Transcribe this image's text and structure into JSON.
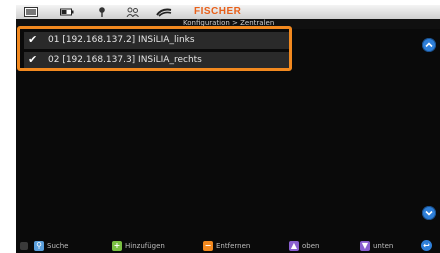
{
  "header": {
    "brand": "FISCHER",
    "breadcrumb": "Konfiguration > Zentralen"
  },
  "list": {
    "items": [
      {
        "label": "01 [192.168.137.2] INSiLIA_links",
        "checked": true
      },
      {
        "label": "02 [192.168.137.3] INSiLIA_rechts",
        "checked": true
      }
    ]
  },
  "footer": {
    "search_label": "Suche",
    "add_label": "Hinzufügen",
    "remove_label": "Entfernen",
    "up_label": "oben",
    "down_label": "unten"
  },
  "colors": {
    "accent": "#f2891f",
    "brand": "#e8601a",
    "scroll": "#2e7fd9"
  },
  "icons": [
    "screen-icon",
    "battery-icon",
    "pin-icon",
    "people-icon",
    "signal-icon",
    "checkmark-icon",
    "scroll-up-icon",
    "scroll-down-icon",
    "search-icon",
    "add-icon",
    "remove-icon",
    "move-up-icon",
    "move-down-icon",
    "back-icon"
  ]
}
